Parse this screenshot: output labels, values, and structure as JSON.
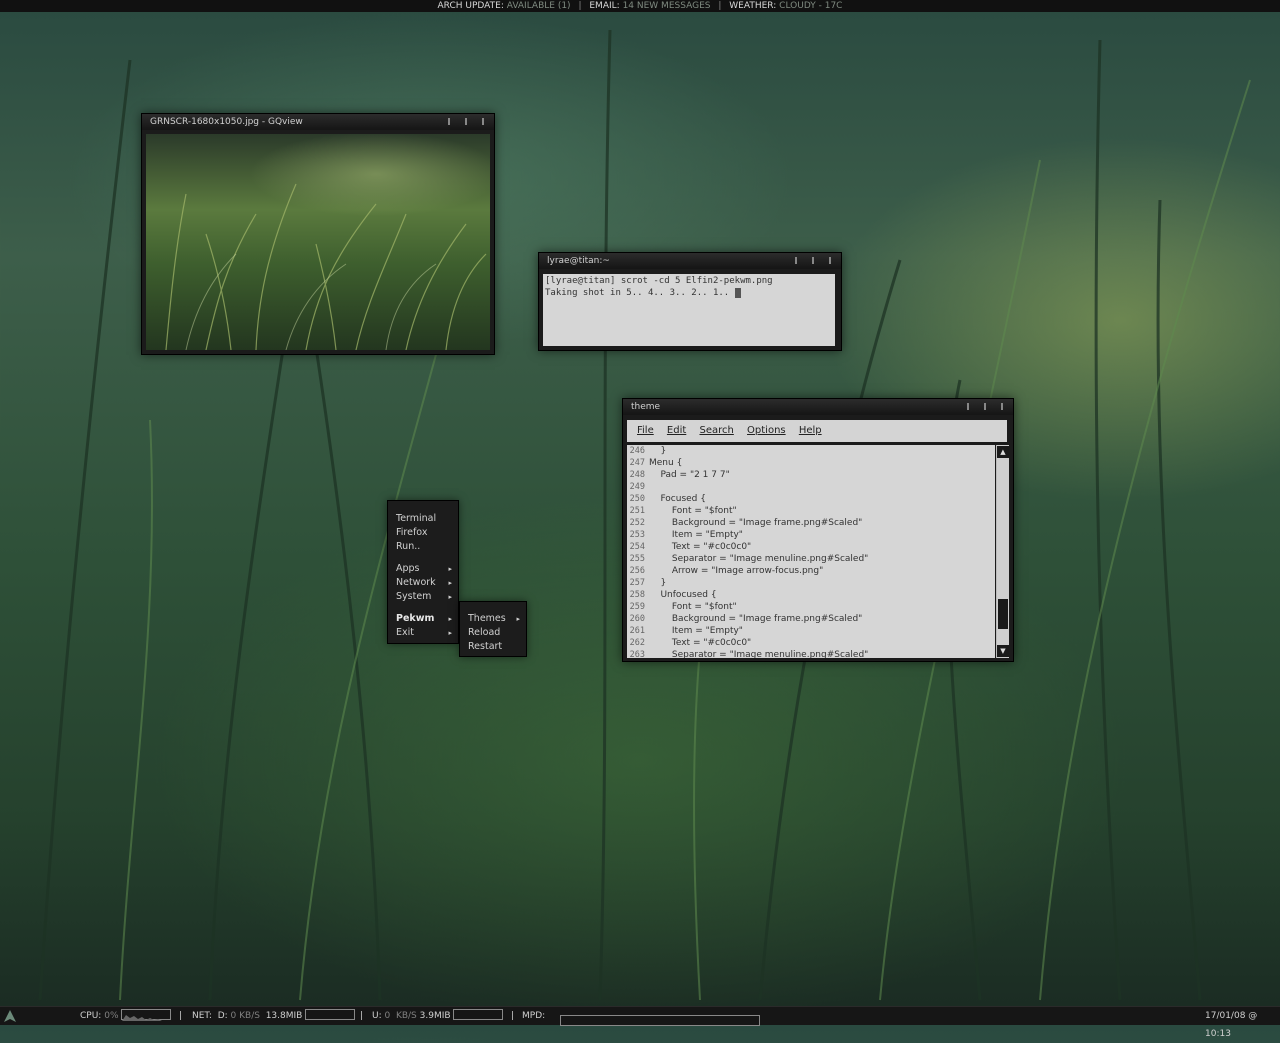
{
  "topbar": {
    "arch_label": "ARCH UPDATE:",
    "arch_value": "AVAILABLE (1)",
    "email_label": "EMAIL:",
    "email_value": "14 NEW MESSAGES",
    "weather_label": "WEATHER:",
    "weather_value": "CLOUDY - 17C",
    "separator": "|"
  },
  "gqview": {
    "title": "GRNSCR-1680x1050.jpg - GQview"
  },
  "terminal": {
    "title": "lyrae@titan:~",
    "line1": "[lyrae@titan] scrot -cd 5 Elfin2-pekwm.png",
    "line2": "Taking shot in 5.. 4.. 3.. 2.. 1.. "
  },
  "editor": {
    "title": "theme",
    "menu": [
      "File",
      "Edit",
      "Search",
      "Options",
      "Help"
    ],
    "lines": [
      {
        "n": "246",
        "text": "    }"
      },
      {
        "n": "247",
        "text": "Menu {"
      },
      {
        "n": "248",
        "text": "    Pad = \"2 1 7 7\""
      },
      {
        "n": "249",
        "text": ""
      },
      {
        "n": "250",
        "text": "    Focused {"
      },
      {
        "n": "251",
        "text": "        Font = \"$font\""
      },
      {
        "n": "252",
        "text": "        Background = \"Image frame.png#Scaled\""
      },
      {
        "n": "253",
        "text": "        Item = \"Empty\""
      },
      {
        "n": "254",
        "text": "        Text = \"#c0c0c0\""
      },
      {
        "n": "255",
        "text": "        Separator = \"Image menuline.png#Scaled\""
      },
      {
        "n": "256",
        "text": "        Arrow = \"Image arrow-focus.png\""
      },
      {
        "n": "257",
        "text": "    }"
      },
      {
        "n": "258",
        "text": "    Unfocused {"
      },
      {
        "n": "259",
        "text": "        Font = \"$font\""
      },
      {
        "n": "260",
        "text": "        Background = \"Image frame.png#Scaled\""
      },
      {
        "n": "261",
        "text": "        Item = \"Empty\""
      },
      {
        "n": "262",
        "text": "        Text = \"#c0c0c0\""
      },
      {
        "n": "263",
        "text": "        Separator = \"Image menuline.png#Scaled\""
      }
    ]
  },
  "root_menu": {
    "terminal": "Terminal",
    "firefox": "Firefox",
    "run": "Run..",
    "apps": "Apps",
    "network": "Network",
    "system": "System",
    "pekwm": "Pekwm",
    "exit": "Exit"
  },
  "pekwm_menu": {
    "themes": "Themes",
    "reload": "Reload",
    "restart": "Restart"
  },
  "bottombar": {
    "cpu_label": "CPU:",
    "cpu_value": "0%",
    "net_label": "NET:",
    "down_label": "D:",
    "down_rate": "0 KB/S",
    "down_total": "13.8MIB",
    "up_label": "U:",
    "up_rate": "0  KB/S",
    "up_total": "3.9MIB",
    "mpd_label": "MPD:",
    "sep": "|",
    "datetime": "17/01/08 @ 10:13"
  }
}
